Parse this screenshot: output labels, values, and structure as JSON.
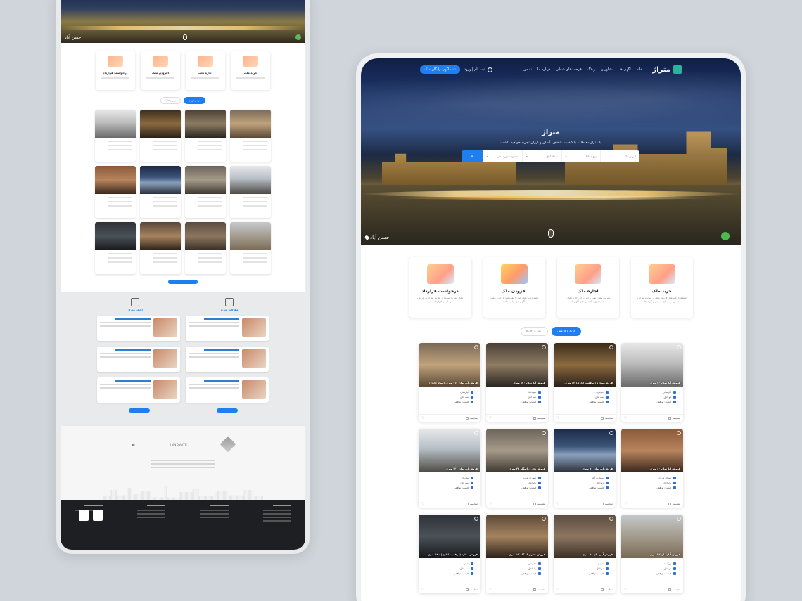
{
  "left_preview": {
    "hero_location": "حسن آباد",
    "services": [
      "درخواست قرارداد",
      "افزودن ملک",
      "اجاره ملک",
      "خرید ملک"
    ],
    "tabs": [
      "خرید و فروش",
      "رهن و اجاره"
    ],
    "articles_heads": [
      "مقالات متراژ",
      "اخبار متراژ"
    ],
    "partner_logos": [
      "INNOVATE"
    ]
  },
  "nav": {
    "brand": "متراژ",
    "menu": [
      "خانه",
      "آگهی ها",
      "مشاورین",
      "وبلاگ",
      "فرصت‌های شغلی",
      "درباره ما",
      "تماس"
    ],
    "login": "ثبت نام | ورود",
    "post_ad": "ثبت آگهی رایگان ملک"
  },
  "hero": {
    "title": "متراژ",
    "subtitle": "با متراژ معاملات با کیفیت، شفاف، آسان و ارزان تجربه خواهید داشت",
    "search_fields": [
      "آدرس ملک",
      "نوع معامله",
      "تعداد اتاق",
      "محدوده مورد نظر"
    ],
    "location": "حسن آباد"
  },
  "services": [
    {
      "title": "خرید ملک",
      "desc": "مشاهده آگهی‌های فروش ملک در سایت متراژ و دسترسی آسان به بهترین گزینه‌ها",
      "icon": "house-sale-icon"
    },
    {
      "title": "اجاره ملک",
      "desc": "تجربه روشی نوین و امن برای اجاره ملک و جستجوی ساده در میان آگهی‌ها",
      "icon": "house-rent-icon"
    },
    {
      "title": "افزودن ملک",
      "desc": "قصد دارید ملک خود را بفروشید یا اجاره دهید؟ آگهی خود را ثبت کنید",
      "icon": "phone-add-icon"
    },
    {
      "title": "درخواست قرارداد",
      "desc": "ملک خود را سریعا از طریق متراژ به فروش برسانید و قرارداد ببندید",
      "icon": "contract-icon"
    }
  ],
  "tabs": {
    "active": "خرید و فروش",
    "inactive": "رهن و اجاره"
  },
  "listings": [
    {
      "title": "فروش آپارتمان ۴۰ متری",
      "features": [
        "آپارتمان",
        "دو اتاق",
        "قیمت: توافقی"
      ],
      "img": "img1"
    },
    {
      "title": "فروش مغازه (موقعیت اداری) ۶۳ متری",
      "features": [
        "خیابان ...",
        "سه اتاق",
        "قیمت: توافقی"
      ],
      "img": "img2"
    },
    {
      "title": "فروش آپارتمان ۱۲۰ متری",
      "features": [
        "میرداماد",
        "سه اتاق",
        "قیمت: توافقی"
      ],
      "img": "img3"
    },
    {
      "title": "فروش آپارتمان ۱۱۲ متری (ستاد جاری)",
      "features": [
        "آپارتمان",
        "سه اتاق",
        "قیمت: توافقی"
      ],
      "img": "img4"
    },
    {
      "title": "فروش آپارتمان ۶۰ متری",
      "features": [
        "میدان هروی",
        "یک اتاق",
        "قیمت: توافقی"
      ],
      "img": "img5"
    },
    {
      "title": "فروش آپارتمان ۷۰ متری",
      "features": [
        "سعادت آباد",
        "دو اتاق",
        "قیمت: توافقی"
      ],
      "img": "img6"
    },
    {
      "title": "فروش تجاری اسکله ۳۸ متری",
      "features": [
        "شهرک غرب",
        "یک اتاق",
        "قیمت: توافقی"
      ],
      "img": "img7"
    },
    {
      "title": "فروش آپارتمان ۱۳۰ متری",
      "features": [
        "نیاوران",
        "سه اتاق",
        "قیمت: توافقی"
      ],
      "img": "img8"
    },
    {
      "title": "فروش آپارتمان ۹۳ متری",
      "features": [
        "زرگنده",
        "دو اتاق",
        "قیمت: توافقی"
      ],
      "img": "img12"
    },
    {
      "title": "فروش آپارتمان ۷۰ متری",
      "features": [
        "جردن",
        "دو اتاق",
        "قیمت: توافقی"
      ],
      "img": "img11"
    },
    {
      "title": "فروش تجاری اسکله ۱۳ متری",
      "features": [
        "تجریش",
        "یک اتاق",
        "قیمت: توافقی"
      ],
      "img": "img10"
    },
    {
      "title": "فروش مغازه (موقعیت اداری) ۱۳۰ متری",
      "features": [
        "صدر",
        "سه اتاق",
        "قیمت: توافقی"
      ],
      "img": "img9"
    }
  ],
  "card_compare": "مقایسه"
}
